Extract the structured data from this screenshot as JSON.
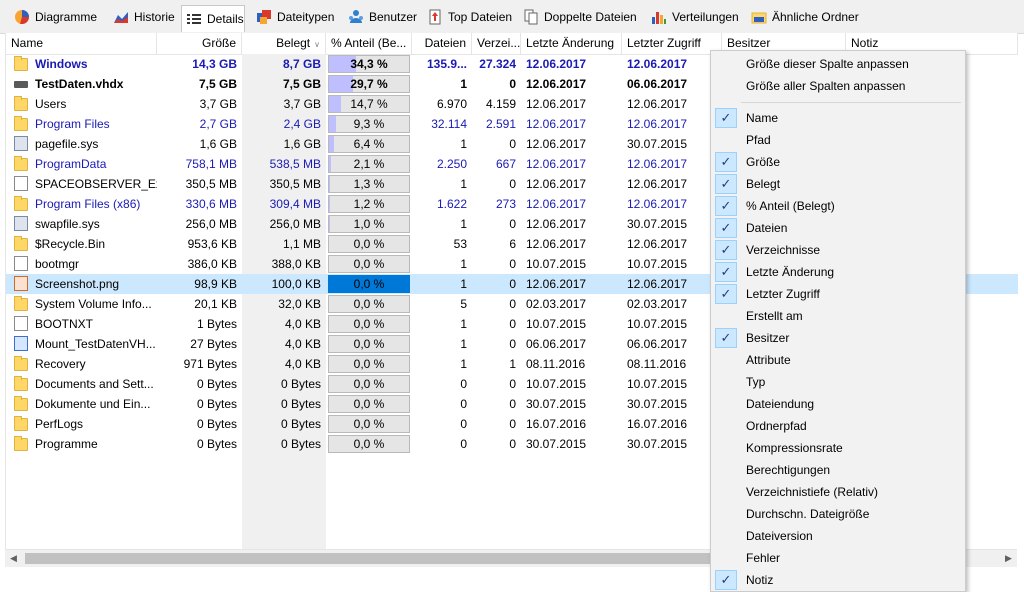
{
  "tabs": [
    {
      "label": "Diagramme",
      "icon": "pie-chart-icon",
      "active": false
    },
    {
      "label": "Historie",
      "icon": "history-chart-icon",
      "active": false
    },
    {
      "label": "Details",
      "icon": "details-list-icon",
      "active": true
    },
    {
      "label": "Dateitypen",
      "icon": "file-types-icon",
      "active": false
    },
    {
      "label": "Benutzer",
      "icon": "users-icon",
      "active": false
    },
    {
      "label": "Top Dateien",
      "icon": "top-files-icon",
      "active": false
    },
    {
      "label": "Doppelte Dateien",
      "icon": "duplicate-files-icon",
      "active": false
    },
    {
      "label": "Verteilungen",
      "icon": "distribution-chart-icon",
      "active": false
    },
    {
      "label": "Ähnliche Ordner",
      "icon": "similar-folders-icon",
      "active": false
    }
  ],
  "columns": [
    "Name",
    "Größe",
    "Belegt",
    "% Anteil (Be...",
    "Dateien",
    "Verzei...",
    "Letzte Änderung",
    "Letzter Zugriff",
    "Besitzer",
    "Notiz"
  ],
  "rows": [
    {
      "icon": "folder-icon",
      "name": "Windows",
      "size": "14,3 GB",
      "used": "8,7 GB",
      "pct_label": "34,3 %",
      "pct": 34.3,
      "files": "135.9...",
      "dirs": "27.324",
      "modified": "12.06.2017",
      "accessed": "12.06.2017",
      "style": "bold-blue"
    },
    {
      "icon": "drive-icon",
      "name": "TestDaten.vhdx",
      "size": "7,5 GB",
      "used": "7,5 GB",
      "pct_label": "29,7 %",
      "pct": 29.7,
      "files": "1",
      "dirs": "0",
      "modified": "12.06.2017",
      "accessed": "06.06.2017",
      "style": "bold"
    },
    {
      "icon": "folder-icon",
      "name": "Users",
      "size": "3,7 GB",
      "used": "3,7 GB",
      "pct_label": "14,7 %",
      "pct": 14.7,
      "files": "6.970",
      "dirs": "4.159",
      "modified": "12.06.2017",
      "accessed": "12.06.2017",
      "style": "normal"
    },
    {
      "icon": "folder-icon",
      "name": "Program Files",
      "size": "2,7 GB",
      "used": "2,4 GB",
      "pct_label": "9,3 %",
      "pct": 9.3,
      "files": "32.114",
      "dirs": "2.591",
      "modified": "12.06.2017",
      "accessed": "12.06.2017",
      "style": "blue"
    },
    {
      "icon": "system-file-icon",
      "name": "pagefile.sys",
      "size": "1,6 GB",
      "used": "1,6 GB",
      "pct_label": "6,4 %",
      "pct": 6.4,
      "files": "1",
      "dirs": "0",
      "modified": "12.06.2017",
      "accessed": "30.07.2015",
      "style": "normal"
    },
    {
      "icon": "folder-icon",
      "name": "ProgramData",
      "size": "758,1 MB",
      "used": "538,5 MB",
      "pct_label": "2,1 %",
      "pct": 2.1,
      "files": "2.250",
      "dirs": "667",
      "modified": "12.06.2017",
      "accessed": "12.06.2017",
      "style": "blue"
    },
    {
      "icon": "file-icon",
      "name": "SPACEOBSERVER_Ex...",
      "size": "350,5 MB",
      "used": "350,5 MB",
      "pct_label": "1,3 %",
      "pct": 1.3,
      "files": "1",
      "dirs": "0",
      "modified": "12.06.2017",
      "accessed": "12.06.2017",
      "style": "normal"
    },
    {
      "icon": "folder-icon",
      "name": "Program Files (x86)",
      "size": "330,6 MB",
      "used": "309,4 MB",
      "pct_label": "1,2 %",
      "pct": 1.2,
      "files": "1.622",
      "dirs": "273",
      "modified": "12.06.2017",
      "accessed": "12.06.2017",
      "style": "blue"
    },
    {
      "icon": "system-file-icon",
      "name": "swapfile.sys",
      "size": "256,0 MB",
      "used": "256,0 MB",
      "pct_label": "1,0 %",
      "pct": 1.0,
      "files": "1",
      "dirs": "0",
      "modified": "12.06.2017",
      "accessed": "30.07.2015",
      "style": "normal"
    },
    {
      "icon": "folder-icon",
      "name": "$Recycle.Bin",
      "size": "953,6 KB",
      "used": "1,1 MB",
      "pct_label": "0,0 %",
      "pct": 0,
      "files": "53",
      "dirs": "6",
      "modified": "12.06.2017",
      "accessed": "12.06.2017",
      "style": "normal"
    },
    {
      "icon": "file-icon",
      "name": "bootmgr",
      "size": "386,0 KB",
      "used": "388,0 KB",
      "pct_label": "0,0 %",
      "pct": 0,
      "files": "1",
      "dirs": "0",
      "modified": "10.07.2015",
      "accessed": "10.07.2015",
      "style": "normal"
    },
    {
      "icon": "image-file-icon",
      "name": "Screenshot.png",
      "size": "98,9 KB",
      "used": "100,0 KB",
      "pct_label": "0,0 %",
      "pct": 0,
      "files": "1",
      "dirs": "0",
      "modified": "12.06.2017",
      "accessed": "12.06.2017",
      "style": "normal",
      "selected": true
    },
    {
      "icon": "folder-icon",
      "name": "System Volume Info...",
      "size": "20,1 KB",
      "used": "32,0 KB",
      "pct_label": "0,0 %",
      "pct": 0,
      "files": "5",
      "dirs": "0",
      "modified": "02.03.2017",
      "accessed": "02.03.2017",
      "style": "normal"
    },
    {
      "icon": "file-icon",
      "name": "BOOTNXT",
      "size": "1 Bytes",
      "used": "4,0 KB",
      "pct_label": "0,0 %",
      "pct": 0,
      "files": "1",
      "dirs": "0",
      "modified": "10.07.2015",
      "accessed": "10.07.2015",
      "style": "normal"
    },
    {
      "icon": "app-file-icon",
      "name": "Mount_TestDatenVH...",
      "size": "27 Bytes",
      "used": "4,0 KB",
      "pct_label": "0,0 %",
      "pct": 0,
      "files": "1",
      "dirs": "0",
      "modified": "06.06.2017",
      "accessed": "06.06.2017",
      "style": "normal"
    },
    {
      "icon": "folder-icon",
      "name": "Recovery",
      "size": "971 Bytes",
      "used": "4,0 KB",
      "pct_label": "0,0 %",
      "pct": 0,
      "files": "1",
      "dirs": "1",
      "modified": "08.11.2016",
      "accessed": "08.11.2016",
      "style": "normal"
    },
    {
      "icon": "folder-icon",
      "name": "Documents and Sett...",
      "size": "0 Bytes",
      "used": "0 Bytes",
      "pct_label": "0,0 %",
      "pct": 0,
      "files": "0",
      "dirs": "0",
      "modified": "10.07.2015",
      "accessed": "10.07.2015",
      "style": "normal"
    },
    {
      "icon": "folder-icon",
      "name": "Dokumente und Ein...",
      "size": "0 Bytes",
      "used": "0 Bytes",
      "pct_label": "0,0 %",
      "pct": 0,
      "files": "0",
      "dirs": "0",
      "modified": "30.07.2015",
      "accessed": "30.07.2015",
      "style": "normal"
    },
    {
      "icon": "folder-icon",
      "name": "PerfLogs",
      "size": "0 Bytes",
      "used": "0 Bytes",
      "pct_label": "0,0 %",
      "pct": 0,
      "files": "0",
      "dirs": "0",
      "modified": "16.07.2016",
      "accessed": "16.07.2016",
      "style": "normal"
    },
    {
      "icon": "folder-icon",
      "name": "Programme",
      "size": "0 Bytes",
      "used": "0 Bytes",
      "pct_label": "0,0 %",
      "pct": 0,
      "files": "0",
      "dirs": "0",
      "modified": "30.07.2015",
      "accessed": "30.07.2015",
      "style": "normal"
    }
  ],
  "context_menu": {
    "top_items": [
      "Größe dieser Spalte anpassen",
      "Größe aller Spalten anpassen"
    ],
    "column_items": [
      {
        "label": "Name",
        "checked": true
      },
      {
        "label": "Pfad",
        "checked": false
      },
      {
        "label": "Größe",
        "checked": true
      },
      {
        "label": "Belegt",
        "checked": true
      },
      {
        "label": "% Anteil (Belegt)",
        "checked": true
      },
      {
        "label": "Dateien",
        "checked": true
      },
      {
        "label": "Verzeichnisse",
        "checked": true
      },
      {
        "label": "Letzte Änderung",
        "checked": true
      },
      {
        "label": "Letzter Zugriff",
        "checked": true
      },
      {
        "label": "Erstellt am",
        "checked": false
      },
      {
        "label": "Besitzer",
        "checked": true
      },
      {
        "label": "Attribute",
        "checked": false
      },
      {
        "label": "Typ",
        "checked": false
      },
      {
        "label": "Dateiendung",
        "checked": false
      },
      {
        "label": "Ordnerpfad",
        "checked": false
      },
      {
        "label": "Kompressionsrate",
        "checked": false
      },
      {
        "label": "Berechtigungen",
        "checked": false
      },
      {
        "label": "Verzeichnistiefe (Relativ)",
        "checked": false
      },
      {
        "label": "Durchschn. Dateigröße",
        "checked": false
      },
      {
        "label": "Dateiversion",
        "checked": false
      },
      {
        "label": "Fehler",
        "checked": false
      },
      {
        "label": "Notiz",
        "checked": true
      }
    ]
  },
  "colors": {
    "accent_blue": "#1a1ab4",
    "selection": "#cce8ff",
    "bar_fill": "#bfbfff",
    "bar_selected": "#0078d7"
  }
}
